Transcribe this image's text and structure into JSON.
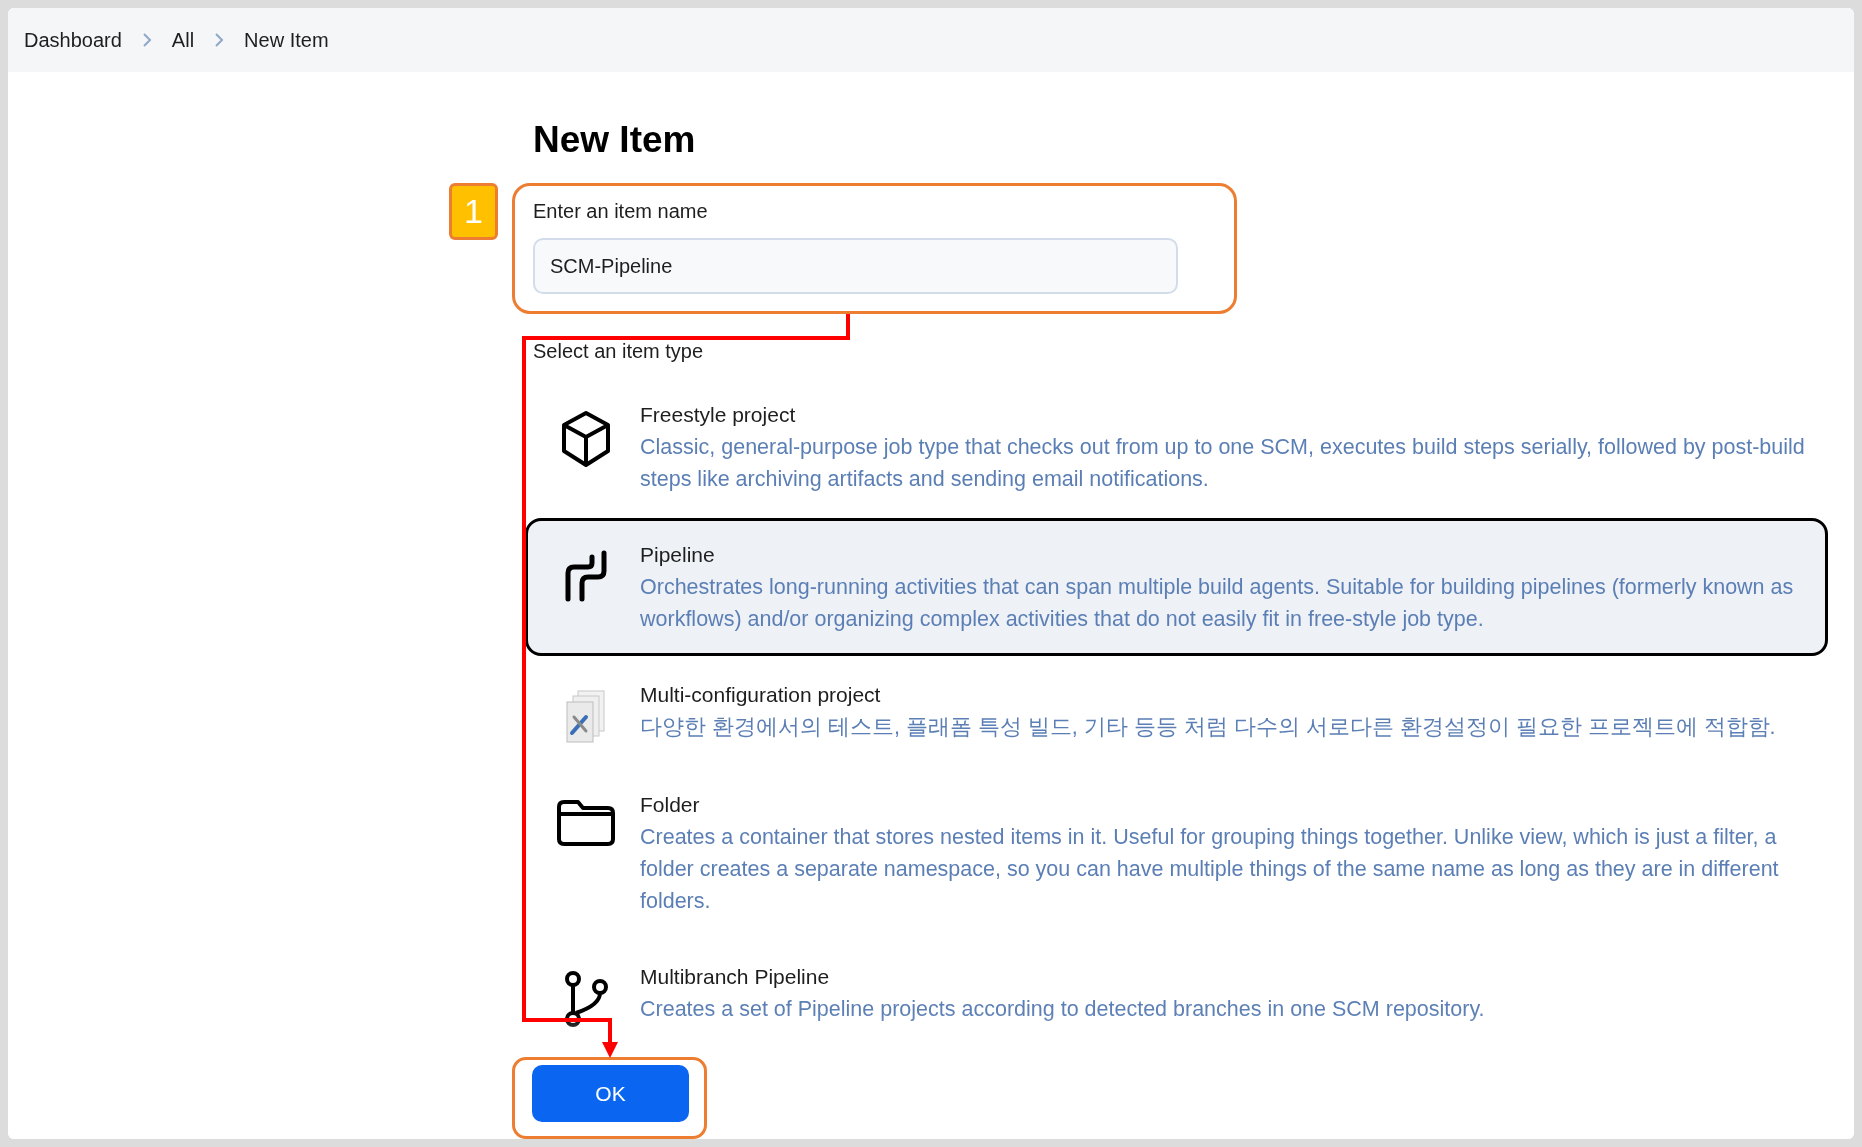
{
  "breadcrumbs": [
    {
      "label": "Dashboard"
    },
    {
      "label": "All"
    },
    {
      "label": "New Item"
    }
  ],
  "title": "New Item",
  "name_field": {
    "label": "Enter an item name",
    "value": "SCM-Pipeline"
  },
  "type_heading": "Select an item type",
  "item_types": [
    {
      "kind": "freestyle",
      "name": "Freestyle project",
      "description": "Classic, general-purpose job type that checks out from up to one SCM, executes build steps serially, followed by post-build steps like archiving artifacts and sending email notifications.",
      "selected": false
    },
    {
      "kind": "pipeline",
      "name": "Pipeline",
      "description": "Orchestrates long-running activities that can span multiple build agents. Suitable for building pipelines (formerly known as workflows) and/or organizing complex activities that do not easily fit in free-style job type.",
      "selected": true
    },
    {
      "kind": "matrix",
      "name": "Multi-configuration project",
      "description": "다양한 환경에서의 테스트, 플래폼 특성 빌드, 기타 등등 처럼 다수의 서로다른 환경설정이 필요한 프로젝트에 적합함.",
      "selected": false
    },
    {
      "kind": "folder",
      "name": "Folder",
      "description": "Creates a container that stores nested items in it. Useful for grouping things together. Unlike view, which is just a filter, a folder creates a separate namespace, so you can have multiple things of the same name as long as they are in different folders.",
      "selected": false
    },
    {
      "kind": "multibranch",
      "name": "Multibranch Pipeline",
      "description": "Creates a set of Pipeline projects according to detected branches in one SCM repository.",
      "selected": false
    }
  ],
  "ok_button": "OK",
  "annotation": {
    "step_badge": "1"
  }
}
